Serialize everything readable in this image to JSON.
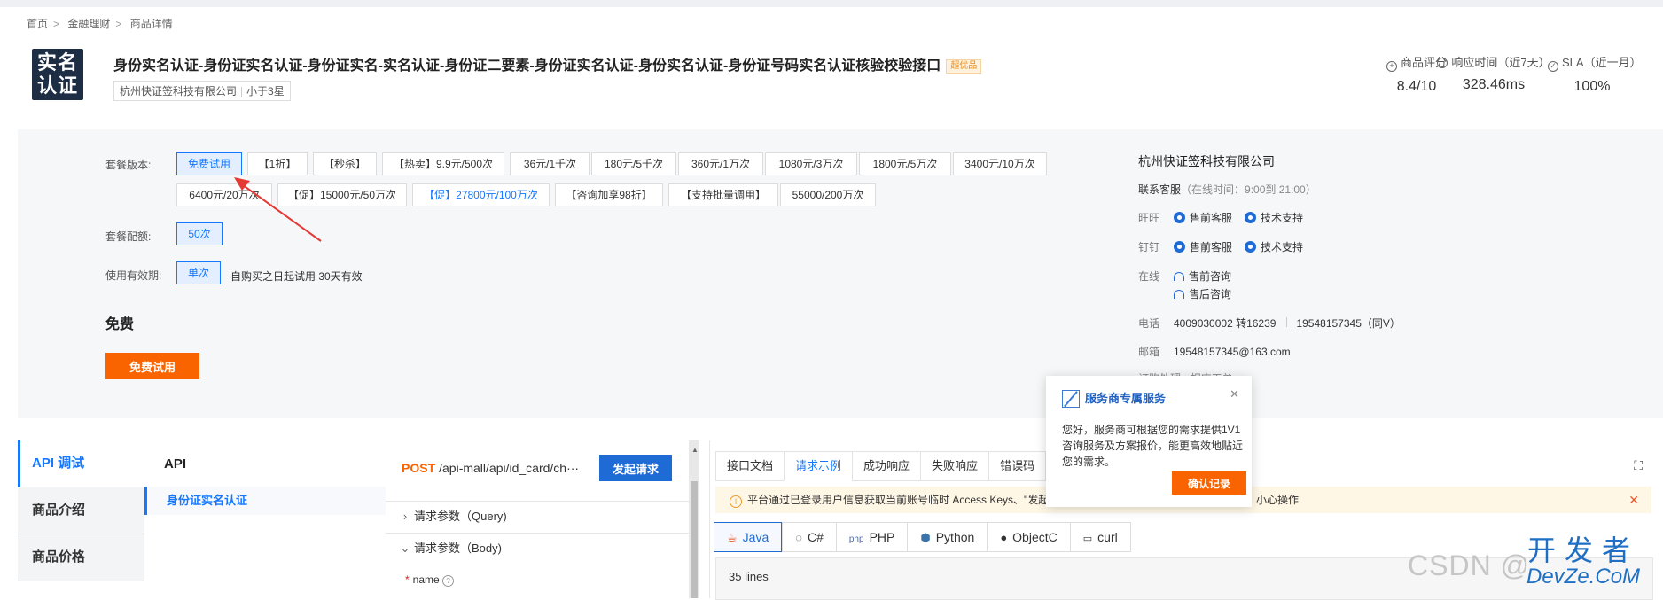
{
  "breadcrumb": [
    "首页",
    "金融理财",
    "商品详情"
  ],
  "product": {
    "logo_line1": "实名",
    "logo_line2": "认证",
    "title": "身份实名认证-身份证实名认证-身份证实名-实名认证-身份证二要素-身份证实名认证-身份实名认证-身份证号码实名认证核验校验接口",
    "badge": "超优品",
    "company": "杭州快证签科技有限公司",
    "company_rating": "小于3星"
  },
  "metrics": [
    {
      "label": "商品评分",
      "value": "8.4/10"
    },
    {
      "label": "响应时间（近7天）",
      "value": "328.46ms"
    },
    {
      "label": "SLA（近一月）",
      "value": "100%"
    }
  ],
  "packages": {
    "version_label": "套餐版本:",
    "versions_row1": [
      "免费试用",
      "【1折】",
      "【秒杀】",
      "【热卖】9.9元/500次",
      "36元/1千次",
      "180元/5千次",
      "360元/1万次",
      "1080元/3万次",
      "1800元/5万次",
      "3400元/10万次"
    ],
    "versions_row2": [
      "6400元/20万次",
      "【促】15000元/50万次",
      "【促】27800元/100万次",
      "【咨询加享98折】",
      "【支持批量调用】",
      "55000/200万次"
    ],
    "quota_label": "套餐配额:",
    "quota": "50次",
    "validity_label": "使用有效期:",
    "validity": "单次",
    "validity_text": "自购买之日起试用 30天有效",
    "price": "免费",
    "try_button": "免费试用"
  },
  "seller": {
    "company": "杭州快证签科技有限公司",
    "service_label": "联系客服",
    "service_hours": "（在线时间：9:00到 21:00）",
    "wangwang_label": "旺旺",
    "dingding_label": "钉钉",
    "presale": "售前客服",
    "tech": "技术支持",
    "online_label": "在线",
    "presale_consult": "售前咨询",
    "aftersale_consult": "售后咨询",
    "phone_label": "电话",
    "phone": "4009030002 转16239",
    "phone2": "19548157345（同V）",
    "email_label": "邮箱",
    "email": "19548157345@163.com",
    "cut_text": "订购处理 · 相应工单"
  },
  "left_nav": [
    "API 调试",
    "商品介绍",
    "商品价格"
  ],
  "api": {
    "header": "API",
    "item": "身份证实名认证",
    "method": "POST",
    "url": "/api-mall/api/id_card/ch···",
    "send": "发起请求",
    "query_params": "请求参数（Query)",
    "body_params": "请求参数（Body)",
    "name_field": "name"
  },
  "doc": {
    "tabs": [
      "接口文档",
      "请求示例",
      "成功响应",
      "失败响应",
      "错误码"
    ],
    "notice": "平台通过已登录用户信息获取当前账号临时 Access Keys、\"发起",
    "notice_tail": "小心操作",
    "langs": [
      "Java",
      "C#",
      "PHP",
      "Python",
      "ObjectC",
      "curl"
    ],
    "lines": "35 lines"
  },
  "popup": {
    "title": "服务商专属服务",
    "text": "您好，服务商可根据您的需求提供1V1咨询服务及方案报价，能更高效地贴近您的需求。",
    "button": "确认记录"
  },
  "watermark": {
    "csdn": "CSDN @",
    "cn": "开发者",
    "en": "DevZe.CoM"
  },
  "colors": {
    "primary": "#1677ff",
    "orange": "#fa6400",
    "panel": "#f6f7f9"
  }
}
